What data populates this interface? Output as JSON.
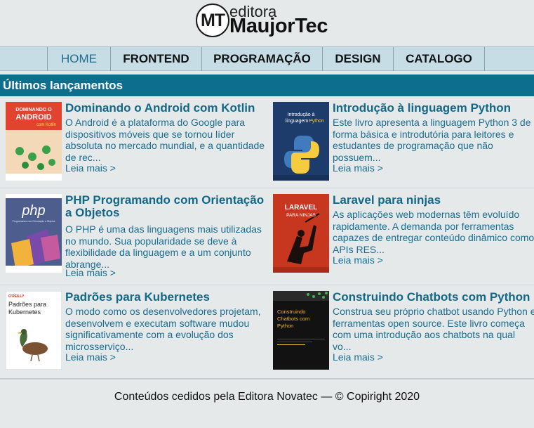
{
  "logo": {
    "monogram": "MT",
    "small_text": "editora",
    "big_text": "MaujorTec"
  },
  "nav": {
    "items": [
      {
        "label": "HOME",
        "active": true
      },
      {
        "label": "FRONTEND",
        "active": false
      },
      {
        "label": "PROGRAMAÇÃO",
        "active": false
      },
      {
        "label": "DESIGN",
        "active": false
      },
      {
        "label": "CATALOGO",
        "active": false
      }
    ]
  },
  "section": {
    "title": "Últimos lançamentos"
  },
  "books": [
    {
      "title": "Dominando o Android com Kotlin",
      "description": "O Android é a plataforma do Google para dispositivos móveis que se tornou líder absoluta no mercado mundial, e a quantidade de rec...",
      "more": "Leia mais >",
      "cover": {
        "line1": "DOMINANDO O",
        "line2": "ANDROID",
        "line3": "com Kotlin",
        "bg": "#e2432f"
      }
    },
    {
      "title": "Introdução à linguagem Python",
      "description": "Este livro apresenta a linguagem Python 3 de forma básica e introdutória para leitores e estudantes de programação que não possuem...",
      "more": "Leia mais >",
      "cover": {
        "line1": "Introdução à",
        "line2": "linguagem",
        "line3": "Python",
        "bg": "#1d3b6b"
      }
    },
    {
      "title": "PHP Programando com Orientação a Objetos",
      "description": "O PHP é uma das linguagens mais utilizadas no mundo. Sua popularidade se deve à flexibilidade da linguagem e a um conjunto abrange...",
      "more": "Leia mais >",
      "cover": {
        "line1": "php",
        "line2": "Programando com Orientação a Objetos",
        "bg": "#4d5e8e"
      }
    },
    {
      "title": "Laravel para ninjas",
      "description": "As aplicações web modernas têm evoluído rapidamente. A demanda por ferramentas capazes de entregar conteúdo dinâmico como APIs RES...",
      "more": "Leia mais >",
      "cover": {
        "line1": "LARAVEL",
        "line2": "PARA NINJAS",
        "bg": "#c7371f"
      }
    },
    {
      "title": "Padrões para Kubernetes",
      "description": "O modo como os desenvolvedores projetam, desenvolvem e executam software mudou significativamente com a evolução dos microsserviço...",
      "more": "Leia mais >",
      "cover": {
        "line1": "O'REILLY",
        "line2": "Padrões para",
        "line3": "Kubernetes",
        "bg": "#ffffff"
      }
    },
    {
      "title": "Construindo Chatbots com Python",
      "description": "Construa seu próprio chatbot usando Python e ferramentas open source. Este livro começa com uma introdução aos chatbots na qual vo...",
      "more": "Leia mais >",
      "cover": {
        "line1": "Construindo",
        "line2": "Chatbots com",
        "line3": "Python",
        "bg": "#121212"
      }
    }
  ],
  "footer": {
    "text": "Conteúdos cedidos pela Editora Novatec — © Copiright 2020"
  }
}
